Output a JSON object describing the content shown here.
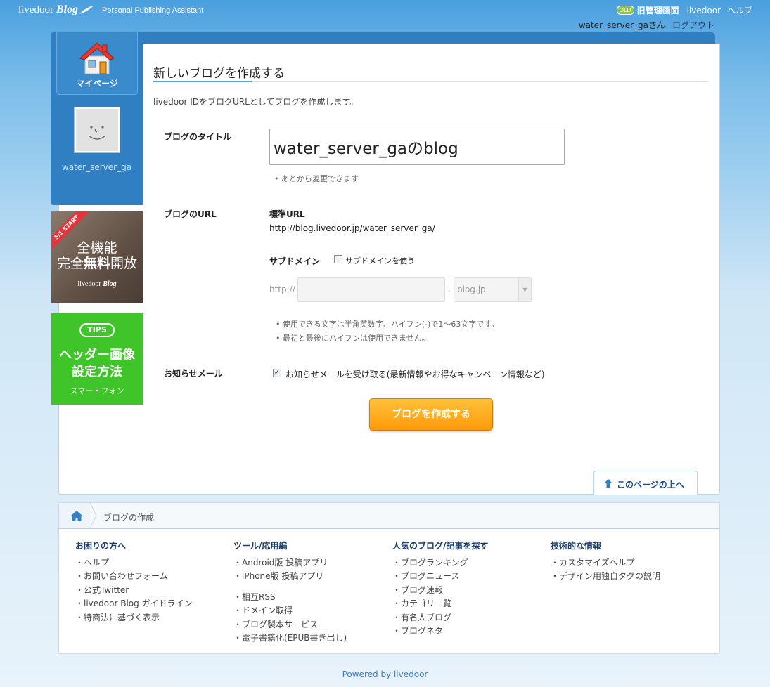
{
  "header": {
    "logo_text": "livedoor",
    "logo_blog": "Blog",
    "tagline": "Personal Publishing Assistant",
    "old_badge": "OLD",
    "old_admin_link": "旧管理画面",
    "livedoor_link": "livedoor",
    "help_link": "ヘルプ",
    "user_greeting": "water_server_gaさん",
    "logout_link": "ログアウト"
  },
  "sidebar": {
    "mypage_label": "マイページ",
    "username": "water_server_ga"
  },
  "banners": {
    "promo": {
      "ribbon": "5/1 START",
      "line1": "全機能",
      "line2_pre": "完全",
      "line2_bold": "無料",
      "line2_post": "開放",
      "logo": "livedoor",
      "logo_blog": "Blog"
    },
    "tips": {
      "badge": "TIPS",
      "line1": "ヘッダー画像",
      "line2": "設定方法",
      "line3": "スマートフォン"
    }
  },
  "form": {
    "page_title": "新しいブログを作成する",
    "intro": "livedoor IDをブログURLとしてブログを作成します。",
    "title_label": "ブログのタイトル",
    "title_value": "water_server_gaのblog",
    "title_note": "• あとから変更できます",
    "url_label": "ブログのURL",
    "std_url_label": "標準URL",
    "std_url_value": "http://blog.livedoor.jp/water_server_ga/",
    "subdomain_label": "サブドメイン",
    "subdomain_checkbox_label": "サブドメインを使う",
    "http_prefix": "http://",
    "subdomain_value": "",
    "dot": ".",
    "domain_select_value": "blog.jp",
    "rule1": "• 使用できる文字は半角英数字、ハイフン(-)で1〜63文字です。",
    "rule2": "• 最初と最後にハイフンは使用できません。",
    "notice_label": "お知らせメール",
    "notice_checkbox_label": "お知らせメールを受け取る(最新情報やお得なキャンペーン情報など)",
    "notice_checked": "✓",
    "create_button": "ブログを作成する",
    "pagetop_link": "このページの上へ"
  },
  "breadcrumb": {
    "current": "ブログの作成"
  },
  "footer": {
    "columns": [
      {
        "title": "お困りの方へ",
        "items": [
          "ヘルプ",
          "お問い合わせフォーム",
          "公式Twitter",
          "livedoor Blog ガイドライン",
          "特商法に基づく表示"
        ]
      },
      {
        "title": "ツール/応用編",
        "items": [
          "Android版 投稿アプリ",
          "iPhone版 投稿アプリ",
          "相互RSS",
          "ドメイン取得",
          "ブログ製本サービス",
          "電子書籍化(EPUB書き出し)"
        ]
      },
      {
        "title": "人気のブログ/記事を探す",
        "items": [
          "ブログランキング",
          "ブログニュース",
          "ブログ速報",
          "カテゴリ一覧",
          "有名人ブログ",
          "ブログネタ"
        ]
      },
      {
        "title": "技術的な情報",
        "items": [
          "カスタマイズヘルプ",
          "デザイン用独自タグの説明"
        ]
      }
    ],
    "powered_by": "Powered by livedoor"
  },
  "colors": {
    "accent_blue": "#2f7fc2",
    "button_orange": "#ff9a0a",
    "tips_green": "#3fc42a"
  }
}
